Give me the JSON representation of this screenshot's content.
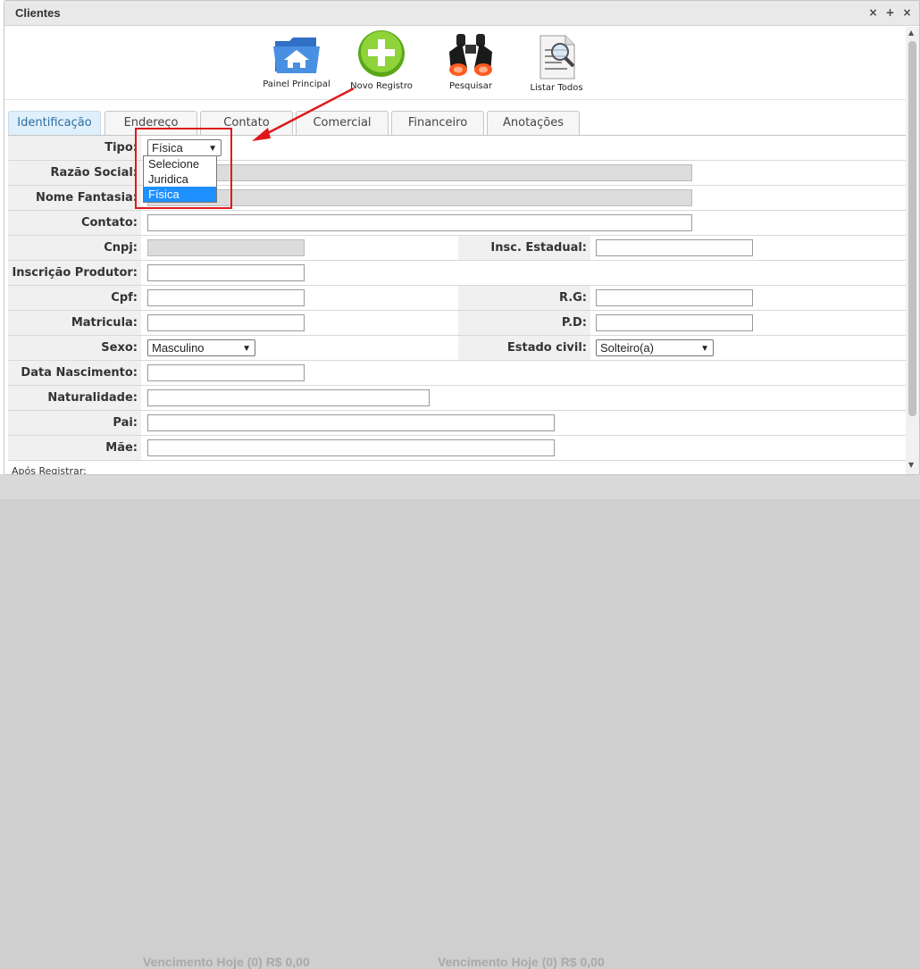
{
  "window": {
    "title": "Clientes",
    "controls": [
      "×",
      "+",
      "×"
    ]
  },
  "toolbar": {
    "items": [
      {
        "label": "Painel Principal",
        "icon": "home-folder-icon"
      },
      {
        "label": "Novo Registro",
        "icon": "add-circle-icon"
      },
      {
        "label": "Pesquisar",
        "icon": "binoculars-icon"
      },
      {
        "label": "Listar Todos",
        "icon": "document-search-icon"
      }
    ]
  },
  "tabs": [
    "Identificação",
    "Endereço",
    "Contato",
    "Comercial",
    "Financeiro",
    "Anotações"
  ],
  "form": {
    "tipo": {
      "label": "Tipo:",
      "value": "Física",
      "options": [
        "Selecione",
        "Juridica",
        "Física"
      ]
    },
    "razao_social": {
      "label": "Razão Social:"
    },
    "nome_fantasia": {
      "label": "Nome Fantasia:"
    },
    "contato": {
      "label": "Contato:"
    },
    "cnpj": {
      "label": "Cnpj:"
    },
    "insc_estadual": {
      "label": "Insc. Estadual:"
    },
    "inscricao_produtor": {
      "label": "Inscrição Produtor:"
    },
    "cpf": {
      "label": "Cpf:"
    },
    "rg": {
      "label": "R.G:"
    },
    "matricula": {
      "label": "Matricula:"
    },
    "pd": {
      "label": "P.D:"
    },
    "sexo": {
      "label": "Sexo:",
      "value": "Masculino"
    },
    "estado_civil": {
      "label": "Estado civil:",
      "value": "Solteiro(a)"
    },
    "data_nascimento": {
      "label": "Data Nascimento:"
    },
    "naturalidade": {
      "label": "Naturalidade:"
    },
    "pai": {
      "label": "Pai:"
    },
    "mae": {
      "label": "Mãe:"
    }
  },
  "footer": {
    "text": "Após Registrar:"
  },
  "background": {
    "text": "Vencimento Hoje (0) R$ 0,00"
  },
  "colors": {
    "active_tab": "#dfeffc",
    "highlight": "#e0181d",
    "selected_option": "#1e90ff"
  }
}
